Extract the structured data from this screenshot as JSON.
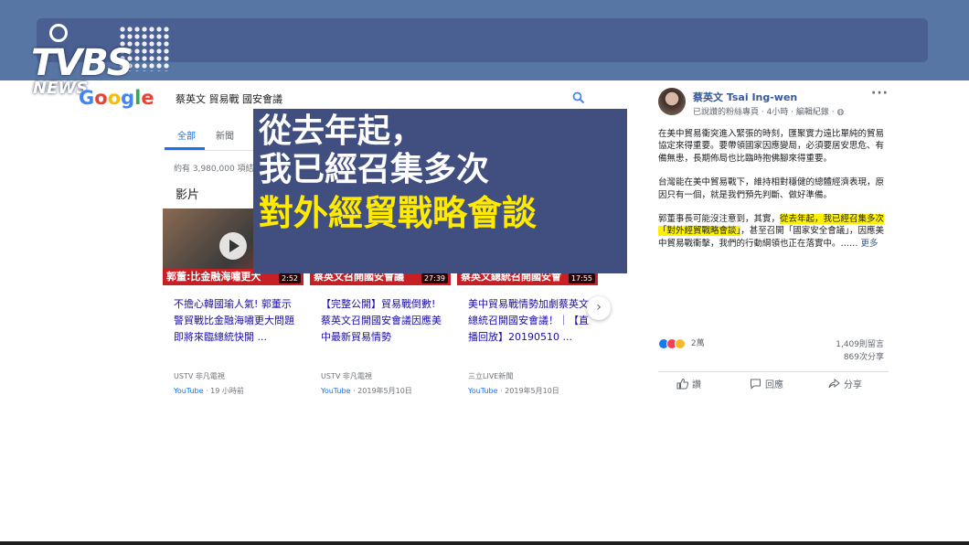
{
  "brand": {
    "logo_letters": "TVBS",
    "logo_news": "NEWS",
    "google_letters": [
      "G",
      "o",
      "o",
      "g",
      "l",
      "e"
    ],
    "colors": {
      "band": "#5876a4",
      "bar": "#4a5f92",
      "overlay": "#414f80",
      "highlight": "#fff200"
    }
  },
  "search": {
    "query": "蔡英文 貿易戰 國安會議",
    "tabs": [
      "全部",
      "新聞"
    ],
    "active_tab": "全部",
    "results_count": "約有 3,980,000 項結",
    "section_title": "影片"
  },
  "videos": [
    {
      "thumb_caption": "郭董:比金融海嘯更大",
      "duration": "2:52",
      "title": "不擔心韓國瑜人氣! 郭董示警貿戰比金融海嘯更大問題即將來臨總統快開 ...",
      "source": "USTV 非凡電視",
      "platform": "YouTube",
      "time": "19 小時前"
    },
    {
      "thumb_caption": "蔡英文召開國安會議",
      "duration": "27:39",
      "title": "【完整公開】貿易戰倒數! 蔡英文召開國安會議因應美中最新貿易情勢",
      "source": "USTV 非凡電視",
      "platform": "YouTube",
      "time": "2019年5月10日"
    },
    {
      "thumb_caption": "蔡英文總統召開國安會",
      "duration": "17:55",
      "title": "美中貿易戰情勢加劇蔡英文總統召開國安會議！｜【直播回放】20190510 ...",
      "source": "三立LIVE新聞",
      "platform": "YouTube",
      "time": "2019年5月10日"
    }
  ],
  "overlay": {
    "line1": "從去年起，",
    "line2": "我已經召集多次",
    "line3": "對外經貿戰略會談"
  },
  "facebook": {
    "name": "蔡英文 Tsai Ing-wen",
    "meta": "已說讚的粉絲專頁 · 4小時 · 編輯紀錄 · ",
    "paragraph1": "在美中貿易衝突進入緊張的時刻，匯聚實力遠比單純的貿易協定來得重要。要帶領國家因應變局，必須要居安思危、有備無患，長期佈局也比臨時抱佛腳來得重要。",
    "paragraph2": "台灣能在美中貿易戰下，維持相對穩健的總體經濟表現，原因只有一個，就是我們預先判斷、做好準備。",
    "p3_before": "郭董事長可能沒注意到，其實，",
    "p3_highlight": "從去年起，我已經召集多次「對外經貿戰略會談」",
    "p3_after": "，甚至召開「國家安全會議」，因應美中貿易戰衝擊，我們的行動綱領也正在落實中。……",
    "more": "更多",
    "reactions_count": "2萬",
    "comments": "1,409則留言",
    "shares": "869次分享",
    "actions": [
      "讚",
      "回應",
      "分享"
    ]
  }
}
